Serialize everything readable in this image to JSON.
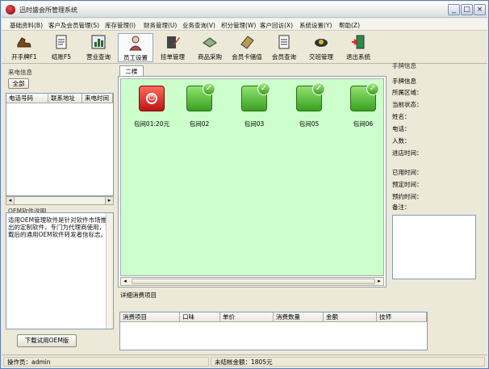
{
  "window": {
    "title": "迅时盛会所管理系统"
  },
  "menubar": {
    "items": [
      "基础资料(B)",
      "客户及会员管理(S)",
      "库存管理(I)",
      "财务管理(U)",
      "业务查询(V)",
      "积分管理(W)",
      "客户回访(X)",
      "系统设置(Y)",
      "帮助(Z)"
    ]
  },
  "toolbar": {
    "buttons": [
      {
        "label": "开手牌F1",
        "icon": "shoe-icon"
      },
      {
        "label": "结账F5",
        "icon": "document-icon"
      },
      {
        "label": "营业查询",
        "icon": "bar-chart-icon"
      },
      {
        "label": "员工设置",
        "icon": "person-icon"
      },
      {
        "label": "挂单管理",
        "icon": "edit-document-icon"
      },
      {
        "label": "商品采购",
        "icon": "shopping-icon"
      },
      {
        "label": "会员卡储值",
        "icon": "card-icon"
      },
      {
        "label": "会员查询",
        "icon": "search-document-icon"
      },
      {
        "label": "交班管理",
        "icon": "handover-icon"
      },
      {
        "label": "退出系统",
        "icon": "exit-door-icon"
      }
    ]
  },
  "caller": {
    "title": "来电信息",
    "all_button": "全部",
    "columns": [
      "电话号码",
      "联系地址",
      "来电时间"
    ]
  },
  "oem": {
    "title": "OEM软件说明",
    "text": "适用OEM管理软件是针对软件市场推出的定制软件，专门为代理商使用，下载后的通用OEM软件转发者信标志。",
    "download_button": "下载试用OEM版"
  },
  "center": {
    "tab": "二楼",
    "rooms": [
      {
        "name": "包间01:20元",
        "status": "busy"
      },
      {
        "name": "包间02",
        "status": "free"
      },
      {
        "name": "包间03",
        "status": "free"
      },
      {
        "name": "包间05",
        "status": "free"
      },
      {
        "name": "包间06",
        "status": "free"
      }
    ],
    "detail_title": "详细消费项目",
    "detail_columns": [
      "消费项目",
      "口味",
      "单价",
      "消费数量",
      "金额",
      "技师"
    ]
  },
  "right": {
    "title": "手牌信息",
    "labels": [
      "手牌信息",
      "所属区域：",
      "当前状态：",
      "姓名：",
      "电话：",
      "人数：",
      "进店时间：",
      "已用时间：",
      "预定时间：",
      "预约时间：",
      "备注："
    ]
  },
  "status": {
    "operator": "操作员：admin",
    "unsettled": "未结帐金额：1805元"
  },
  "colors": {
    "room_area": "#ccffcc",
    "free": "#3aa021",
    "busy": "#c01414"
  }
}
